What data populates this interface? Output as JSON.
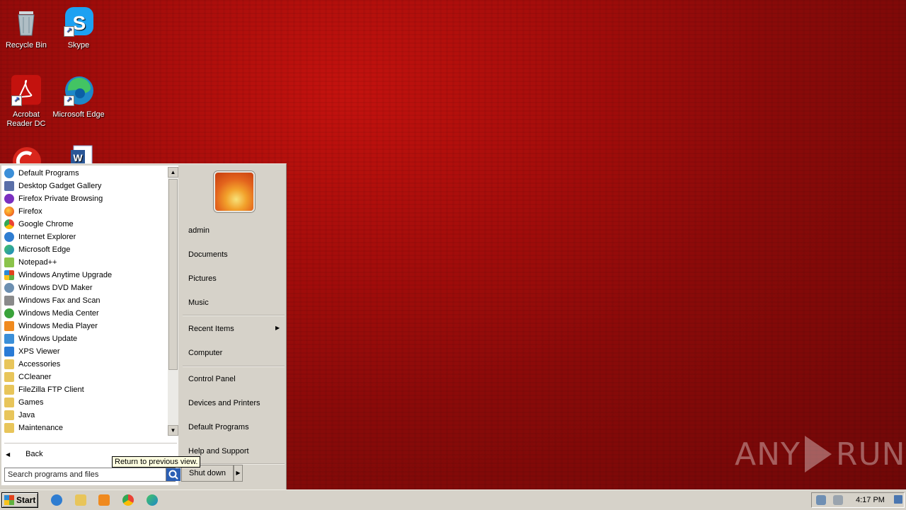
{
  "desktop": {
    "icons": [
      {
        "label": "Recycle Bin",
        "icon": "recycle-bin-icon"
      },
      {
        "label": "Skype",
        "icon": "skype-icon"
      },
      {
        "label": "Acrobat Reader DC",
        "icon": "acrobat-icon"
      },
      {
        "label": "Microsoft Edge",
        "icon": "edge-icon"
      },
      {
        "label": "",
        "icon": "ccleaner-icon"
      },
      {
        "label": "",
        "icon": "word-icon"
      }
    ]
  },
  "start_menu": {
    "programs": [
      {
        "label": "Default Programs",
        "icon": "default-programs-icon",
        "color": "#3b8fd8"
      },
      {
        "label": "Desktop Gadget Gallery",
        "icon": "gadget-icon",
        "color": "#5a6fa8"
      },
      {
        "label": "Firefox Private Browsing",
        "icon": "firefox-private-icon",
        "color": "#7b2fbf"
      },
      {
        "label": "Firefox",
        "icon": "firefox-icon",
        "color": "#f47a1f"
      },
      {
        "label": "Google Chrome",
        "icon": "chrome-icon",
        "color": "#4caf50"
      },
      {
        "label": "Internet Explorer",
        "icon": "ie-icon",
        "color": "#2f7dd1"
      },
      {
        "label": "Microsoft Edge",
        "icon": "edge-icon",
        "color": "#1e88c8"
      },
      {
        "label": "Notepad++",
        "icon": "notepadpp-icon",
        "color": "#8bc34a"
      },
      {
        "label": "Windows Anytime Upgrade",
        "icon": "upgrade-icon",
        "color": "#3b8fd8"
      },
      {
        "label": "Windows DVD Maker",
        "icon": "dvd-icon",
        "color": "#6c8fb0"
      },
      {
        "label": "Windows Fax and Scan",
        "icon": "fax-icon",
        "color": "#8a8a8a"
      },
      {
        "label": "Windows Media Center",
        "icon": "media-center-icon",
        "color": "#3aa33a"
      },
      {
        "label": "Windows Media Player",
        "icon": "media-player-icon",
        "color": "#f08a1e"
      },
      {
        "label": "Windows Update",
        "icon": "windows-update-icon",
        "color": "#3b8fd8"
      },
      {
        "label": "XPS Viewer",
        "icon": "xps-icon",
        "color": "#2a7bd6"
      },
      {
        "label": "Accessories",
        "icon": "folder-icon",
        "color": "#e8c55a"
      },
      {
        "label": "CCleaner",
        "icon": "folder-icon",
        "color": "#e8c55a"
      },
      {
        "label": "FileZilla FTP Client",
        "icon": "folder-icon",
        "color": "#e8c55a"
      },
      {
        "label": "Games",
        "icon": "folder-icon",
        "color": "#e8c55a"
      },
      {
        "label": "Java",
        "icon": "folder-icon",
        "color": "#e8c55a"
      },
      {
        "label": "Maintenance",
        "icon": "folder-icon",
        "color": "#e8c55a"
      }
    ],
    "back_label": "Back",
    "search_placeholder": "Search programs and files",
    "right_items": {
      "user": "admin",
      "documents": "Documents",
      "pictures": "Pictures",
      "music": "Music",
      "recent_items": "Recent Items",
      "computer": "Computer",
      "control_panel": "Control Panel",
      "devices_printers": "Devices and Printers",
      "default_programs": "Default Programs",
      "help_support": "Help and Support"
    },
    "shutdown_label": "Shut down",
    "tooltip": "Return to previous view."
  },
  "taskbar": {
    "start_label": "Start",
    "pinned": [
      "ie-icon",
      "explorer-icon",
      "media-player-icon",
      "chrome-icon",
      "edge-icon"
    ],
    "clock": "4:17 PM"
  },
  "watermark": {
    "left": "ANY",
    "right": "RUN"
  }
}
